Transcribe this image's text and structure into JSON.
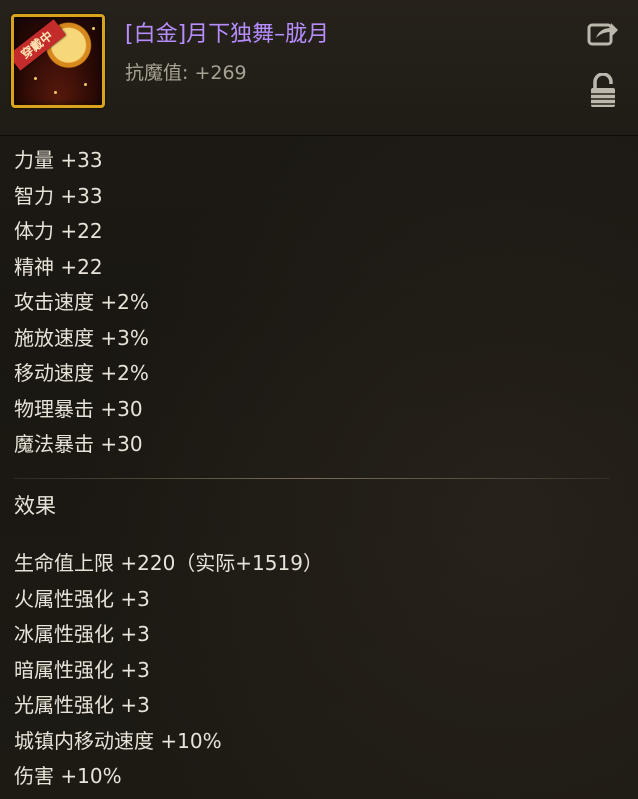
{
  "item": {
    "badge": "穿戴中",
    "name": "[白金]月下独舞–胧月",
    "resist": "抗魔值: +269"
  },
  "icons": {
    "share": "share-arrow-icon",
    "lock": "unlock-padlock-icon"
  },
  "stats": [
    "力量 +33",
    "智力 +33",
    "体力 +22",
    "精神 +22",
    "攻击速度 +2%",
    "施放速度 +3%",
    "移动速度 +2%",
    "物理暴击 +30",
    "魔法暴击 +30"
  ],
  "effects_title": "效果",
  "effects": [
    "生命值上限 +220（实际+1519）",
    "火属性强化 +3",
    "冰属性强化 +3",
    "暗属性强化 +3",
    "光属性强化 +3",
    "城镇内移动速度 +10%",
    "伤害 +10%"
  ],
  "colors": {
    "item_name": "#b68cff",
    "frame_gold": "#d9a31b",
    "badge_red": "#c42b2b"
  }
}
